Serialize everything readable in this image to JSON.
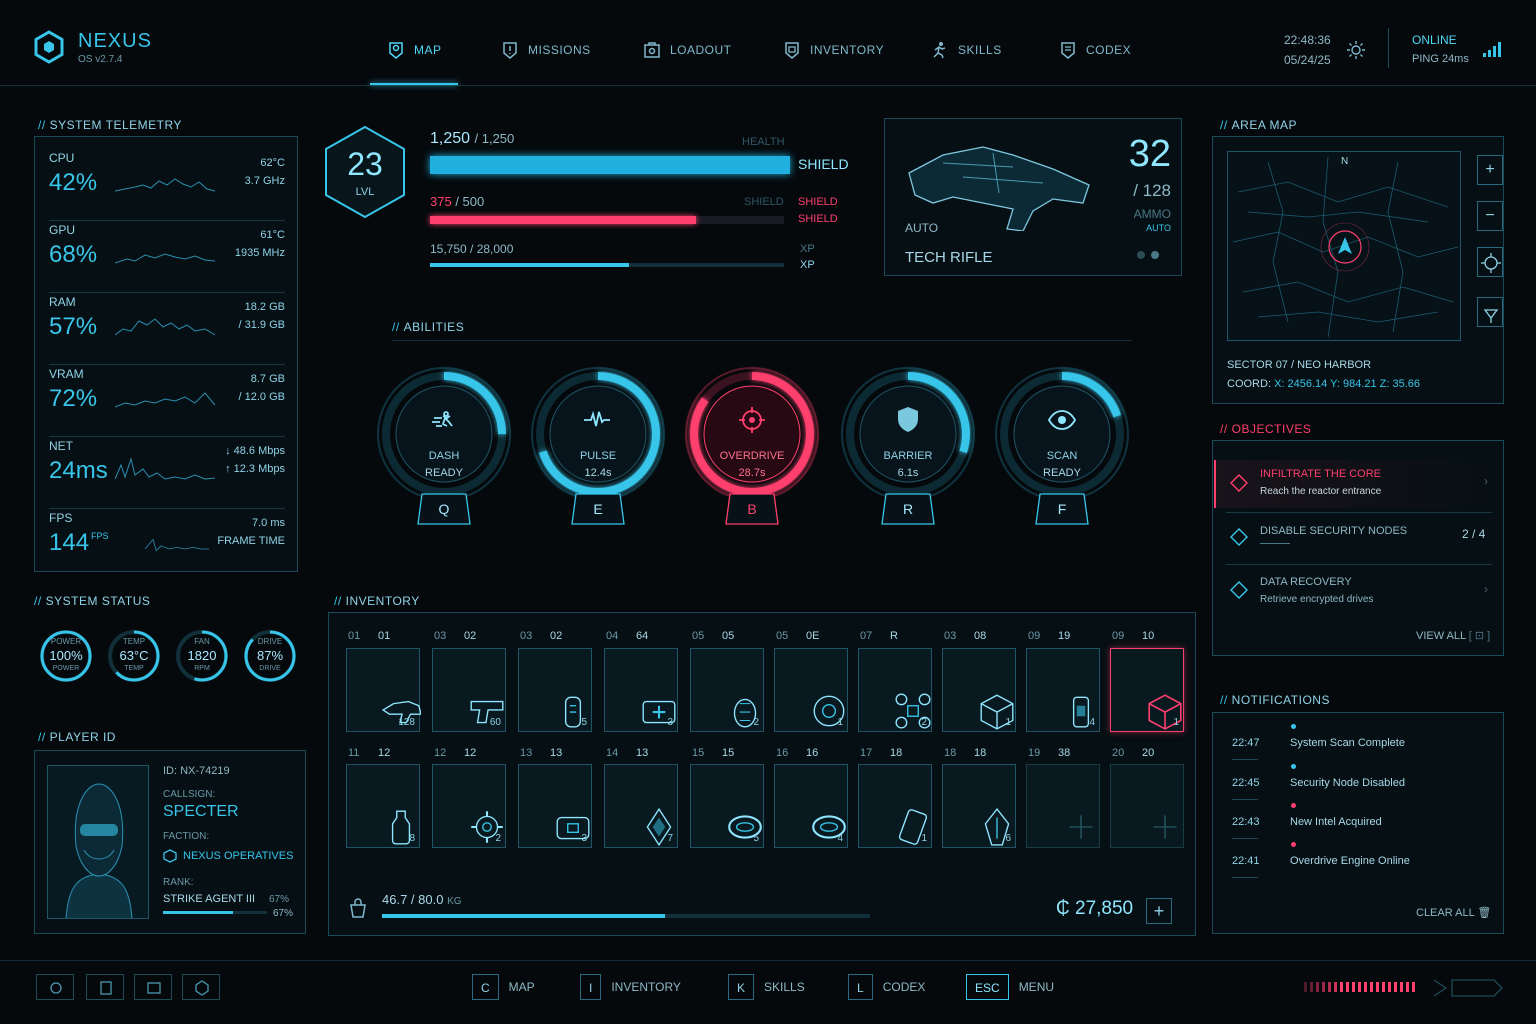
{
  "app": {
    "title": "NEXUS",
    "version": "OS v2.7.4"
  },
  "nav": {
    "items": [
      {
        "label": "MAP",
        "icon": "map-icon",
        "active": true
      },
      {
        "label": "MISSIONS",
        "icon": "missions-icon"
      },
      {
        "label": "LOADOUT",
        "icon": "loadout-icon"
      },
      {
        "label": "INVENTORY",
        "icon": "inventory-icon"
      },
      {
        "label": "SKILLS",
        "icon": "skills-icon"
      },
      {
        "label": "CODEX",
        "icon": "codex-icon"
      }
    ]
  },
  "clock": {
    "time": "22:48:36",
    "date": "05/24/25"
  },
  "connection": {
    "status": "ONLINE",
    "ping": "PING 24ms"
  },
  "telemetry": {
    "title": "SYSTEM TELEMETRY",
    "rows": [
      {
        "label": "CPU",
        "value": "42%",
        "r1": "62°C",
        "r2": "3.7 GHz"
      },
      {
        "label": "GPU",
        "value": "68%",
        "r1": "61°C",
        "r2": "1935 MHz"
      },
      {
        "label": "RAM",
        "value": "57%",
        "r1": "18.2 GB",
        "r2": "/ 31.9 GB"
      },
      {
        "label": "VRAM",
        "value": "72%",
        "r1": "8.7 GB",
        "r2": "/ 12.0 GB"
      },
      {
        "label": "NET",
        "value": "24ms",
        "r1": "↓ 48.6 Mbps",
        "r2": "↑ 12.3 Mbps"
      },
      {
        "label": "FPS",
        "value": "144",
        "unit": "FPS",
        "r1": "7.0 ms",
        "r2": "FRAME TIME"
      }
    ]
  },
  "system_status": {
    "title": "SYSTEM STATUS",
    "gauges": [
      {
        "top": "POWER",
        "value": "100%",
        "label": "POWER",
        "level": 1.0
      },
      {
        "top": "TEMP",
        "value": "63°C",
        "label": "TEMP",
        "level": 0.63
      },
      {
        "top": "FAN",
        "value": "1820",
        "label": "RPM",
        "level": 0.55
      },
      {
        "top": "DRIVE",
        "value": "87%",
        "label": "DRIVE",
        "level": 0.87
      }
    ]
  },
  "player": {
    "title": "PLAYER ID",
    "id": "ID: NX-74219",
    "callsign_label": "CALLSIGN:",
    "callsign": "SPECTER",
    "faction_label": "FACTION:",
    "faction": "NEXUS OPERATIVES",
    "rank_label": "RANK:",
    "rank": "STRIKE AGENT III",
    "rank_progress": "67%",
    "rank_level": 0.67
  },
  "status_bars": {
    "level": "23",
    "level_label": "LVL",
    "health": {
      "current": "1,250",
      "max": "/ 1,250",
      "label": "HEALTH",
      "level": 1.0
    },
    "shield": {
      "current": "375",
      "max": "/ 500",
      "label": "SHIELD",
      "level": 0.75
    },
    "xp": {
      "text": "15,750 / 28,000",
      "label": "XP",
      "level": 0.5625
    },
    "side_labels": [
      "SHIELD",
      "SHIELD",
      "SHIELD",
      "XP",
      "XP"
    ]
  },
  "weapon": {
    "name": "TECH RIFLE",
    "mode": "AUTO",
    "ammo": "32",
    "ammo_max": "/ 128",
    "ammo_label": "AMMO",
    "ammo_sub": "AUTO"
  },
  "abilities": {
    "title": "ABILITIES",
    "items": [
      {
        "name": "DASH",
        "status": "READY",
        "key": "Q",
        "icon": "dash-icon",
        "color": "#37c5ea",
        "level": 0.25
      },
      {
        "name": "PULSE",
        "status": "12.4s",
        "key": "E",
        "icon": "pulse-icon",
        "color": "#37c5ea",
        "level": 0.7
      },
      {
        "name": "OVERDRIVE",
        "status": "28.7s",
        "key": "B",
        "icon": "target-icon",
        "color": "#ff3f6e",
        "level": 0.85
      },
      {
        "name": "BARRIER",
        "status": "6.1s",
        "key": "R",
        "icon": "shield-icon",
        "color": "#37c5ea",
        "level": 0.3
      },
      {
        "name": "SCAN",
        "status": "READY",
        "key": "F",
        "icon": "eye-icon",
        "color": "#37c5ea",
        "level": 0.2
      }
    ]
  },
  "inventory": {
    "title": "INVENTORY",
    "row1": [
      {
        "n1": "01",
        "n2": "01",
        "qty": "128",
        "icon": "rifle-icon"
      },
      {
        "n1": "03",
        "n2": "02",
        "qty": "60",
        "icon": "pistol-icon"
      },
      {
        "n1": "03",
        "n2": "02",
        "qty": "5",
        "icon": "grenade-icon"
      },
      {
        "n1": "04",
        "n2": "64",
        "qty": "3",
        "icon": "medkit-icon"
      },
      {
        "n1": "05",
        "n2": "05",
        "qty": "2",
        "icon": "frag-icon"
      },
      {
        "n1": "05",
        "n2": "0E",
        "qty": "1",
        "icon": "mine-icon"
      },
      {
        "n1": "07",
        "n2": "R",
        "qty": "2",
        "icon": "drone-icon"
      },
      {
        "n1": "03",
        "n2": "08",
        "qty": "1",
        "icon": "cube-icon"
      },
      {
        "n1": "09",
        "n2": "19",
        "qty": "4",
        "icon": "canister-icon"
      },
      {
        "n1": "09",
        "n2": "10",
        "qty": "1",
        "icon": "crate-icon",
        "rare": true
      }
    ],
    "row2": [
      {
        "n1": "11",
        "n2": "12",
        "qty": "8",
        "icon": "vial-icon"
      },
      {
        "n1": "12",
        "n2": "12",
        "qty": "2",
        "icon": "gear-icon"
      },
      {
        "n1": "13",
        "n2": "13",
        "qty": "3",
        "icon": "case-icon"
      },
      {
        "n1": "14",
        "n2": "13",
        "qty": "7",
        "icon": "crystal-icon"
      },
      {
        "n1": "15",
        "n2": "15",
        "qty": "5",
        "icon": "ring-icon"
      },
      {
        "n1": "16",
        "n2": "16",
        "qty": "4",
        "icon": "ring-icon"
      },
      {
        "n1": "17",
        "n2": "18",
        "qty": "1",
        "icon": "datapad-icon"
      },
      {
        "n1": "18",
        "n2": "18",
        "qty": "6",
        "icon": "shard-icon"
      },
      {
        "n1": "19",
        "n2": "38",
        "qty": "",
        "icon": "plus-icon",
        "empty": true
      },
      {
        "n1": "20",
        "n2": "20",
        "qty": "",
        "icon": "plus-icon",
        "empty": true
      }
    ],
    "weight": "46.7 / 80.0",
    "weight_unit": "KG",
    "weight_level": 0.58,
    "credits": "₵ 27,850"
  },
  "area_map": {
    "title": "AREA MAP",
    "north": "N",
    "sector": "SECTOR 07 / NEO HARBOR",
    "coord_label": "COORD:",
    "coord": "X: 2456.14   Y: 984.21   Z: 35.66"
  },
  "objectives": {
    "title": "OBJECTIVES",
    "items": [
      {
        "title": "INFILTRATE THE CORE",
        "sub": "Reach the reactor entrance",
        "active": true
      },
      {
        "title": "DISABLE SECURITY NODES",
        "sub": "",
        "progress": "2 / 4"
      },
      {
        "title": "DATA RECOVERY",
        "sub": "Retrieve encrypted drives"
      }
    ],
    "view_all": "VIEW ALL"
  },
  "notifications": {
    "title": "NOTIFICATIONS",
    "items": [
      {
        "time": "22:47",
        "text": "System Scan Complete",
        "color": "#37c5ea"
      },
      {
        "time": "22:45",
        "text": "Security Node Disabled",
        "color": "#37c5ea"
      },
      {
        "time": "22:43",
        "text": "New Intel Acquired",
        "color": "#ff3f6e"
      },
      {
        "time": "22:41",
        "text": "Overdrive Engine Online",
        "color": "#ff3f6e"
      }
    ],
    "clear_all": "CLEAR ALL"
  },
  "hotkeys": [
    {
      "key": "C",
      "label": "MAP"
    },
    {
      "key": "I",
      "label": "INVENTORY"
    },
    {
      "key": "K",
      "label": "SKILLS"
    },
    {
      "key": "L",
      "label": "CODEX"
    },
    {
      "key": "ESC",
      "label": "MENU"
    }
  ],
  "colors": {
    "accent": "#37c5ea",
    "alert": "#ff3f6e",
    "bg": "#05090c"
  }
}
